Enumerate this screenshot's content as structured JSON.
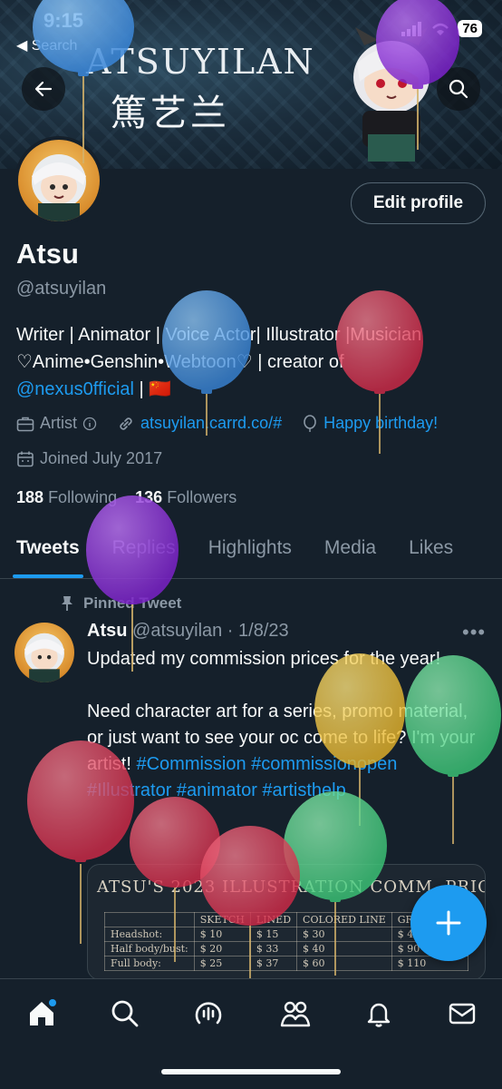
{
  "status_bar": {
    "time": "9:15",
    "back_label": "◀ Search",
    "battery": "76"
  },
  "banner": {
    "title": "ATSUYILAN",
    "chinese": "篤艺兰"
  },
  "profile": {
    "edit_button": "Edit profile",
    "name": "Atsu",
    "handle": "@atsuyilan",
    "bio_line1": "Writer | Animator | Voice Actor| Illustrator |Musician",
    "bio_line2": "♡Anime•Genshin•Webtoon♡ | creator of",
    "bio_link": "@nexus0fficial",
    "bio_flag": " | 🇨🇳",
    "category": "Artist",
    "website": "atsuyilan.carrd.co/#",
    "birthday": "Happy birthday!",
    "joined": "Joined July 2017",
    "following_count": "188",
    "following_label": "Following",
    "followers_count": "136",
    "followers_label": "Followers"
  },
  "tabs": [
    "Tweets",
    "Replies",
    "Highlights",
    "Media",
    "Likes"
  ],
  "tweet": {
    "pinned_label": "Pinned Tweet",
    "author": "Atsu",
    "meta": "@atsuyilan · 1/8/23",
    "text_line1": "Updated my commission prices for the year!",
    "text_para2": "Need character art for a series, promo material, or just want to see your oc come to life? I'm your artist!",
    "hashtags": "#Commission #commissionopen #Illustrator #animator #artisthelp",
    "media_title": "ATSU'S 2023 ILLUSTRATION COMM. PRICES",
    "media_columns": [
      "SKETCH",
      "LINED",
      "COLORED LINE",
      "GREYSCALE"
    ],
    "media_rows": [
      {
        "label": "Headshot:",
        "cells": [
          "$ 10",
          "$ 15",
          "$ 30",
          "$ 40"
        ]
      },
      {
        "label": "Half body/bust:",
        "cells": [
          "$ 20",
          "$ 33",
          "$ 40",
          "$ 90"
        ]
      },
      {
        "label": "Full body:",
        "cells": [
          "$ 25",
          "$ 37",
          "$ 60",
          "$ 110"
        ]
      }
    ]
  },
  "colors": {
    "background": "#15202b",
    "accent": "#1d9bf0",
    "muted": "#8b98a5",
    "border": "#38444d"
  },
  "icons": [
    "back-arrow-icon",
    "search-icon",
    "briefcase-icon",
    "link-icon",
    "balloon-icon",
    "calendar-icon",
    "pin-icon",
    "more-icon",
    "plus-icon",
    "home-icon",
    "spaces-icon",
    "communities-icon",
    "bell-icon",
    "mail-icon"
  ]
}
